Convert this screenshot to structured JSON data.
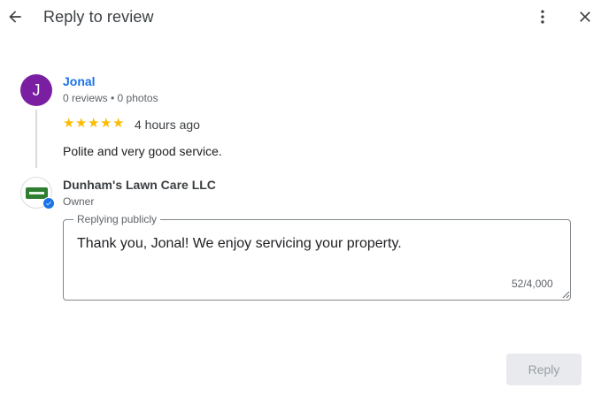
{
  "header": {
    "title": "Reply to review",
    "back_icon": "arrow-back-icon",
    "more_icon": "more-vert-icon",
    "close_icon": "close-icon"
  },
  "review": {
    "avatar_letter": "J",
    "avatar_color": "#7b1fa2",
    "reviewer_name": "Jonal",
    "reviewer_meta": "0 reviews • 0 photos",
    "rating": 5,
    "star_color": "#fbbc04",
    "time_ago": "4 hours ago",
    "text": "Polite and very good service."
  },
  "owner": {
    "business_name": "Dunham's Lawn Care LLC",
    "role": "Owner",
    "verified_icon": "verified-check-icon"
  },
  "reply": {
    "legend": "Replying publicly",
    "text": "Thank you, Jonal! We enjoy servicing your property.",
    "char_count": "52/4,000"
  },
  "actions": {
    "reply_label": "Reply"
  },
  "colors": {
    "accent": "#1a73e8",
    "disabled_button_bg": "#e8eaed",
    "disabled_button_text": "#9aa0a6"
  }
}
